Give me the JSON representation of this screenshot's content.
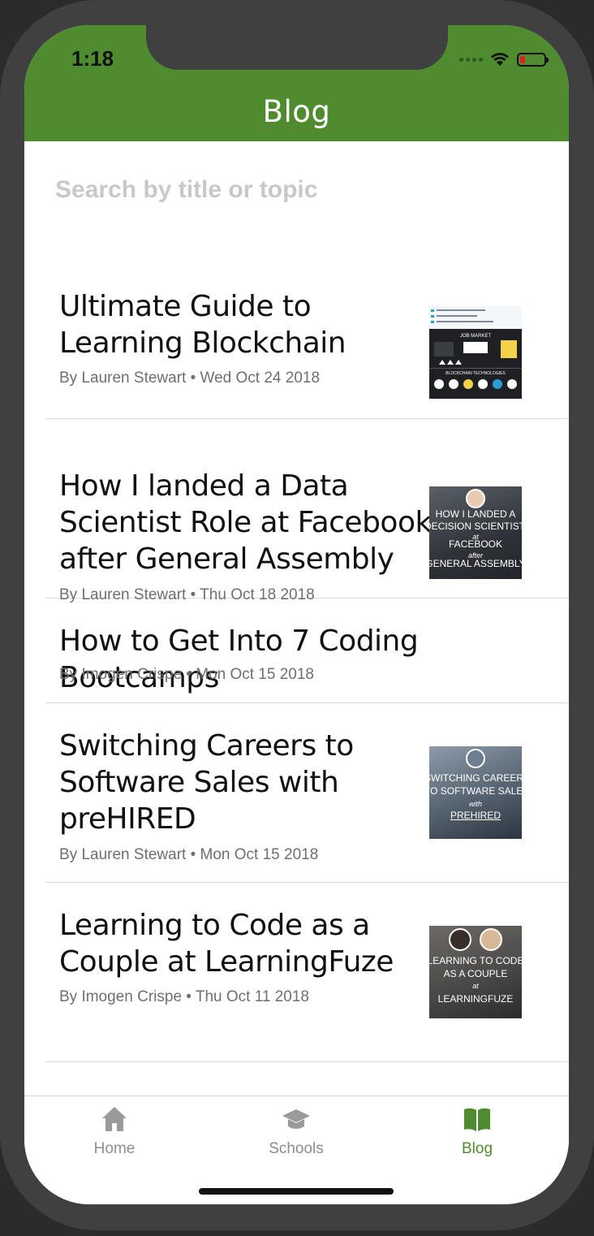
{
  "status_bar": {
    "time": "1:18"
  },
  "header": {
    "title": "Blog"
  },
  "search": {
    "placeholder": "Search by title or topic"
  },
  "posts": [
    {
      "title_lines": [
        "Ultimate Guide to",
        "Learning Blockchain"
      ],
      "meta": "By Lauren Stewart • Wed Oct 24 2018",
      "thumb": {
        "type": "infographic",
        "lines": [
          "JOB MARKET",
          "BLOCKCHAIN TECHNOLOGIES"
        ]
      }
    },
    {
      "title_lines": [
        "How I landed a Data",
        "Scientist Role at Facebook",
        "after General Assembly"
      ],
      "meta": "By Lauren Stewart • Thu Oct 18 2018",
      "thumb": {
        "type": "photo",
        "lines": [
          "HOW I LANDED A",
          "DECISION SCIENTIST ROLE",
          "at",
          "FACEBOOK",
          "after",
          "GENERAL ASSEMBLY"
        ]
      }
    },
    {
      "title_lines": [
        "How to Get Into 7 Coding Bootcamps"
      ],
      "meta": "By Imogen Crispe • Mon Oct 15 2018"
    },
    {
      "title_lines": [
        "Switching Careers to",
        "Software Sales with",
        "preHIRED"
      ],
      "meta": "By Lauren Stewart • Mon Oct 15 2018",
      "thumb": {
        "type": "photo",
        "lines": [
          "SWITCHING CAREERS",
          "TO SOFTWARE SALES",
          "with",
          "PREHIRED"
        ]
      }
    },
    {
      "title_lines": [
        "Learning to Code as a",
        "Couple at LearningFuze"
      ],
      "meta": "By Imogen Crispe • Thu Oct 11 2018",
      "thumb": {
        "type": "photo",
        "lines": [
          "LEARNING TO CODE",
          "AS A COUPLE",
          "at",
          "LEARNINGFUZE"
        ]
      }
    }
  ],
  "tabs": [
    {
      "label": "Home",
      "icon": "home-icon",
      "active": false
    },
    {
      "label": "Schools",
      "icon": "graduation-cap-icon",
      "active": false
    },
    {
      "label": "Blog",
      "icon": "open-book-icon",
      "active": true
    }
  ],
  "colors": {
    "brand_green": "#4f8c30",
    "tab_inactive": "#8e8e8e",
    "meta_gray": "#6f6f6f"
  }
}
